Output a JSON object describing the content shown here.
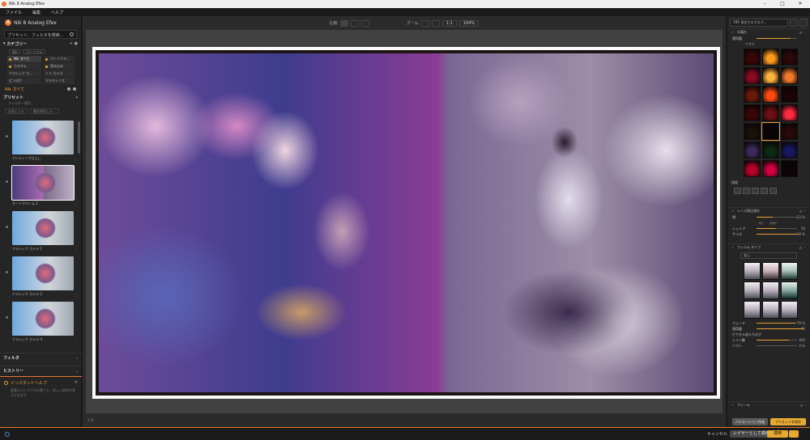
{
  "window": {
    "title": "Nik 8 Analog Efex"
  },
  "menu": [
    "ファイル",
    "編集",
    "ヘルプ"
  ],
  "left": {
    "app_name": "Nik 8 Analog Efex",
    "search_placeholder": "プリセット、フィルタを検索...",
    "category_title": "カテゴリー",
    "chip1": "Nik",
    "chip2": "パーソナル",
    "categories": [
      "Nik すべて",
      "パーソナル...",
      "カスタム",
      "読み込み",
      "クラシック カ...",
      "トイ カメラ",
      "ピンぼけ",
      "マルチレンズ"
    ],
    "nik_all": "Nik すべて",
    "presets_title": "プリセット",
    "filter_text": "フィルター適用...",
    "btn_fav": "お気に入り",
    "btn_recent": "最近使用した...",
    "presets": [
      "アンティーク仕上し",
      "ネートクローム 2",
      "クラシック カメラ 1",
      "クラシック カメラ 2",
      "クラシック カメラ 4"
    ],
    "filter_section": "フィルタ",
    "history_section": "ヒストリー",
    "help_title": "インスタントヘルプ",
    "help_body": "要素の上にマウスを置くと、詳しい説明が表示されます"
  },
  "toolbar": {
    "compare": "比較",
    "zoom": "ズーム",
    "one": "1:1",
    "zoom_value": "104%"
  },
  "status": "1 of",
  "right": {
    "export": "TIFF 形式でエクスプ...",
    "light_leaks": "光漏れ",
    "apply_amount": "適用量",
    "soft": "ソフト",
    "swatch_colors": [
      "#3a0708",
      "#ff9a1e",
      "#2a0a08",
      "#8a0a20",
      "#ffb43c",
      "#f07a2a",
      "#6a1a0a",
      "#ff4a12",
      "#1a0406",
      "#3c0608",
      "#6c1016",
      "#ff2a40",
      "#1a1208",
      "#0a0404",
      "#2a0a0c",
      "#3a2a5a",
      "#0c2a14",
      "#181860",
      "#b8002a",
      "#d40040",
      "#0c0408"
    ],
    "section_tools": "描画",
    "lens_vignette": "レンズ周辺減光",
    "brightness": "明",
    "brightness_val": "-23 %",
    "circle": "円形",
    "rect": "四角形",
    "shape": "シェイプ",
    "shape_val": "30",
    "size": "サイズ",
    "size_val": "98 %",
    "film_type": "フィルム タイプ",
    "film_select": "なし",
    "fade": "フェード",
    "fade_val": "79 %",
    "strength": "適用量",
    "strength_val": "95",
    "grain": "ピクセルあたりのグ",
    "grain2": "レイン数",
    "grain_val": "400",
    "soft2": "ソフト",
    "soft2_val": "0 %",
    "frame": "フレーム",
    "variation": "バリエーション作成",
    "save_preset": "プリセットを保存"
  },
  "bottom": {
    "cancel": "キャンセル",
    "layer": "レイヤーとして適用",
    "apply": "適用"
  }
}
